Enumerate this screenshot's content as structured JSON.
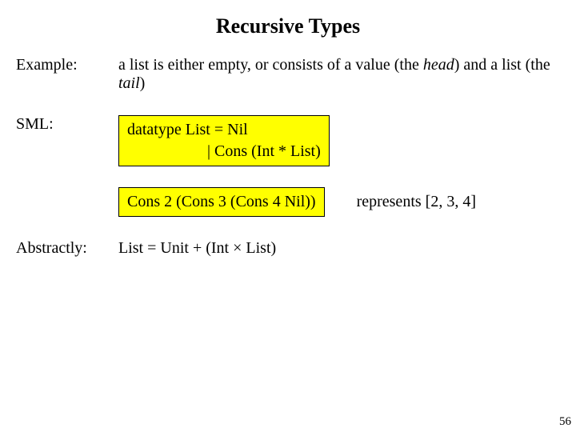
{
  "title": "Recursive Types",
  "example": {
    "label": "Example:",
    "text_before_head": "a list is either empty, or consists of a value (the ",
    "head_word": "head",
    "text_mid": ") and a list (the ",
    "tail_word": "tail",
    "text_after": ")"
  },
  "sml": {
    "label": "SML:",
    "code_line1": "datatype List = Nil",
    "code_line2": "| Cons (Int * List)",
    "expr": "Cons 2 (Cons 3 (Cons 4 Nil))",
    "represents": "represents [2, 3, 4]"
  },
  "abstractly": {
    "label": "Abstractly:",
    "text": "List = Unit + (Int × List)"
  },
  "page_number": "56"
}
